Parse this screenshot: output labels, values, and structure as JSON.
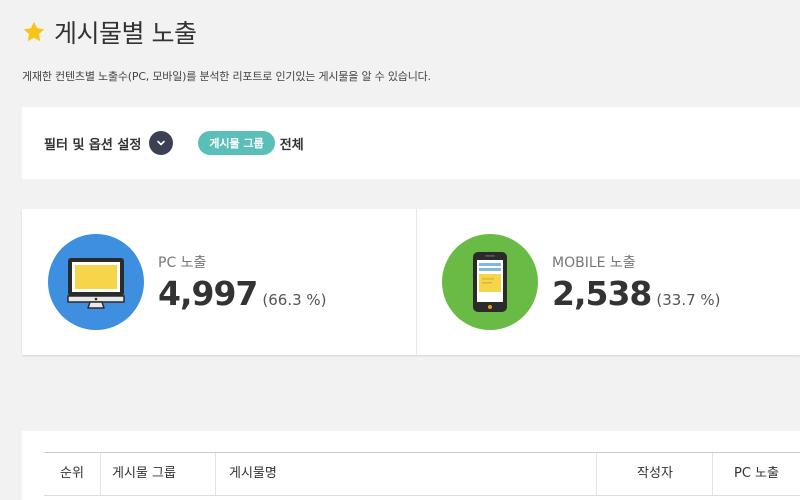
{
  "header": {
    "icon": "star-icon",
    "title": "게시물별 노출",
    "description": "게재한 컨텐츠별 노출수(PC, 모바일)를 분석한 리포트로 인기있는 게시물을 알 수 있습니다."
  },
  "filter": {
    "label": "필터 및 옵션 설정",
    "toggle_icon": "chevron-down-icon",
    "chip_label": "게시물 그룹",
    "chip_value": "전체"
  },
  "stats": {
    "pc": {
      "icon": "monitor-icon",
      "label": "PC 노출",
      "value": "4,997",
      "percent": "(66.3 %)",
      "color": "#3e8fe0"
    },
    "mobile": {
      "icon": "smartphone-icon",
      "label": "MOBILE 노출",
      "value": "2,538",
      "percent": "(33.7 %)",
      "color": "#6aba46"
    }
  },
  "table": {
    "columns": [
      "순위",
      "게시물 그룹",
      "게시물명",
      "작성자",
      "PC 노출"
    ]
  },
  "colors": {
    "background": "#f2f2f2",
    "chip": "#5bbfb9",
    "toggle": "#3d3f52",
    "star": "#f5c518"
  }
}
